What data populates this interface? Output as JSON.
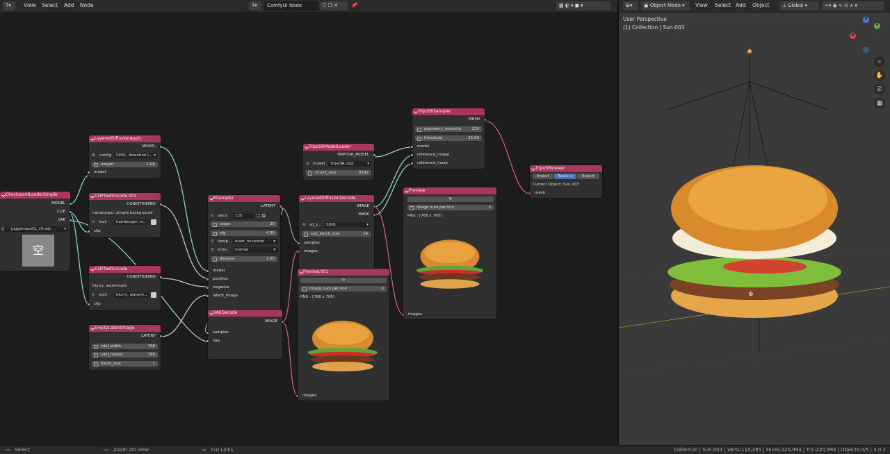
{
  "left_header": {
    "editor_icon": "node-editor-icon",
    "menus": [
      "View",
      "Select",
      "Add",
      "Node"
    ],
    "tree_name": "ComfyUI Node"
  },
  "right_header": {
    "mode": "Object Mode",
    "menus": [
      "View",
      "Select",
      "Add",
      "Object"
    ],
    "orientation": "Global"
  },
  "viewport": {
    "perspective": "User Perspective",
    "collection": "(1) Collection | Sun.003",
    "gizmo": {
      "y": "Y",
      "z": "Z",
      "x": "X"
    }
  },
  "nodes": {
    "checkpoint": {
      "title": "CheckpointLoaderSimple",
      "outputs": [
        "MODEL",
        "CLIP",
        "VAE"
      ],
      "ckpt": "juggernautXL_v9.saf...",
      "thumb_glyph": "空"
    },
    "layered_apply": {
      "title": "LayeredDiffusionApply",
      "output": "MODEL",
      "config_label": "config",
      "config_value": "SDXL, Attention I...",
      "weight_label": "weight",
      "weight_value": "1.00",
      "input": "model"
    },
    "clip_pos": {
      "title": "CLIPTextEncode.001",
      "output": "CONDITIONING",
      "prompt": "hamburger, simple background",
      "text_label": "text:",
      "text_value": "hamburger, si...",
      "input": "clip"
    },
    "clip_neg": {
      "title": "CLIPTextEncode",
      "output": "CONDITIONING",
      "prompt": "blurry, watermark",
      "text_label": "text:",
      "text_value": "blurry, waterm...",
      "input": "clip"
    },
    "empty_latent": {
      "title": "EmptyLatentImage",
      "output": "LATENT",
      "fields": [
        {
          "label": "sdxl_width",
          "value": "768"
        },
        {
          "label": "sdxl_height",
          "value": "768"
        },
        {
          "label": "batch_size",
          "value": "1"
        }
      ]
    },
    "ksampler": {
      "title": "KSampler",
      "output": "LATENT",
      "seed_label": "seed:",
      "seed_value": "125",
      "steps_label": "steps",
      "steps_value": "20",
      "cfg_label": "cfg",
      "cfg_value": "4.00",
      "sampler_label": "samp...",
      "sampler_value": "euler_ancestral",
      "scheduler_label": "sche...",
      "scheduler_value": "normal",
      "denoise_label": "denoise",
      "denoise_value": "1.00",
      "inputs": [
        "model",
        "positive",
        "negative",
        "latent_image"
      ]
    },
    "vae_decode": {
      "title": "VAEDecode",
      "output": "IMAGE",
      "inputs": [
        "samples",
        "vae"
      ]
    },
    "layered_decode": {
      "title": "LayeredDiffusionDecode",
      "outputs": [
        "IMAGE",
        "MASK"
      ],
      "sd_label": "sd_v...",
      "sd_value": "SDXL",
      "batch_label": "sub_batch_size",
      "batch_value": "14",
      "inputs": [
        "samples",
        "images"
      ]
    },
    "preview_001": {
      "title": "Preview.001",
      "refresh_icon": "refresh-icon",
      "num_label": "Image num per line",
      "num_value": "3",
      "info": "PNG : [768 x 768]",
      "input": "images"
    },
    "preview": {
      "title": "Preview",
      "refresh_icon": "refresh-icon",
      "num_label": "Image num per line",
      "num_value": "3",
      "info": "PNG : [768 x 768]",
      "input": "images"
    },
    "tripo_loader": {
      "title": "TripoSRModelLoader",
      "output": "TRIPOSR_MODEL",
      "model_label": "model:",
      "model_value": "TripoSR.ckpt",
      "chunk_label": "chunk_size",
      "chunk_value": "8192"
    },
    "tripo_sampler": {
      "title": "TripoSRSampler",
      "output": "MESH",
      "res_label": "geometry_resolutio",
      "res_value": "256",
      "thr_label": "threshold",
      "thr_value": "25.00",
      "inputs": [
        "model",
        "reference_image",
        "reference_mask"
      ]
    },
    "tripo_viewer": {
      "title": "TripoSRViewer",
      "buttons": [
        "Import",
        "Replace",
        "Export"
      ],
      "current": "Current Object: Sun.003",
      "input": "mesh"
    }
  },
  "status_bar": {
    "select": "Select",
    "zoom": "Zoom 2D View",
    "cut": "Cut Links",
    "stats": "Collection | Sun.003 | Verts:110,485 | Faces:220,994 | Tris:220,994 | Objects:0/5 | 4.0.2"
  },
  "colors": {
    "node_header": "#a9375b",
    "socket_teal": "#6fc6c6",
    "socket_pink": "#d3588a",
    "socket_grey": "#a0a0a0",
    "link_teal": "#8fd0c9",
    "link_pink": "#d3588a",
    "link_grey": "#9a9a9a"
  }
}
